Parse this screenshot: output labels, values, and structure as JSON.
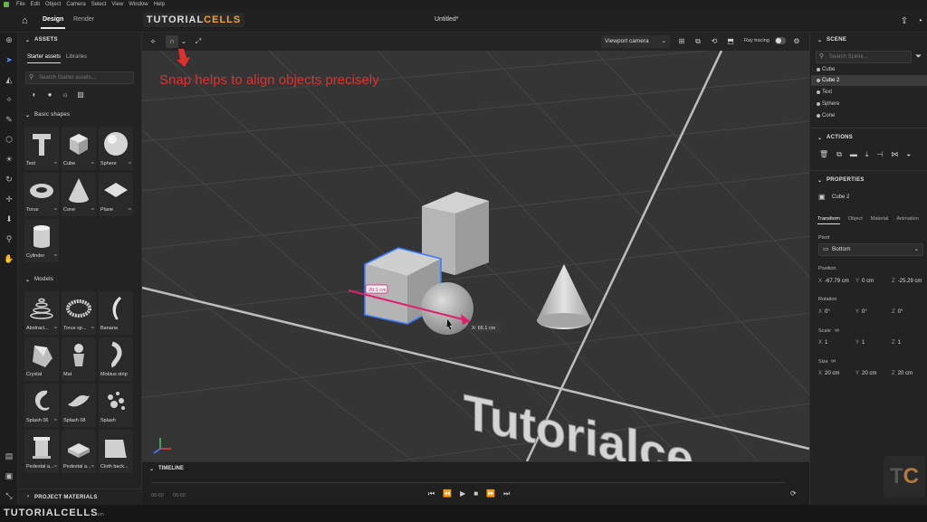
{
  "menu": [
    "File",
    "Edit",
    "Object",
    "Camera",
    "Select",
    "View",
    "Window",
    "Help"
  ],
  "header": {
    "tabs": [
      {
        "label": "Design"
      },
      {
        "label": "Render"
      }
    ],
    "brand_main": "TUTORIAL",
    "brand_accent": "CELLS",
    "doc_title": "Untitled*"
  },
  "assets": {
    "title": "ASSETS",
    "subtabs": [
      "Starter assets",
      "Libraries"
    ],
    "search_placeholder": "Search Starter assets...",
    "basic_shapes_title": "Basic shapes",
    "basic_shapes": [
      "Text",
      "Cube",
      "Sphere",
      "Torus",
      "Cone",
      "Plane",
      "Cylinder"
    ],
    "models_title": "Models",
    "models": [
      "Abstract...",
      "Torus sp...",
      "Banana",
      "Crystal",
      "Mat",
      "Mobius strip",
      "Splash 06",
      "Splash 08",
      "Splash",
      "Pedestal a...",
      "Pedestal a...",
      "Cloth back..."
    ],
    "project_materials": "PROJECT MATERIALS"
  },
  "viewport": {
    "camera_label": "Viewport camera",
    "raytracing_label": "Ray tracing",
    "annotation": "Snap helps to align objects precisely",
    "measure_1": "20.1 cm",
    "measure_2": "X: 65.1 cm",
    "floor_text": "Tutorialce"
  },
  "timeline": {
    "title": "TIMELINE",
    "time_start": "00:00",
    "time_end": "00:00"
  },
  "scene": {
    "title": "SCENE",
    "search_placeholder": "Search Scene...",
    "items": [
      "Cube",
      "Cube 2",
      "Text",
      "Sphere",
      "Cone"
    ],
    "selected_index": 1
  },
  "actions": {
    "title": "ACTIONS"
  },
  "properties": {
    "title": "PROPERTIES",
    "object_name": "Cube 2",
    "tabs": [
      "Transform",
      "Object",
      "Material",
      "Animation"
    ],
    "pivot_label": "Pivot",
    "pivot_value": "Bottom",
    "position_label": "Position",
    "position": {
      "x": "-67.79 cm",
      "y": "0 cm",
      "z": "-25.29 cm"
    },
    "rotation_label": "Rotation",
    "rotation": {
      "x": "0°",
      "y": "0°",
      "z": "0°"
    },
    "scale_label": "Scale",
    "scale": {
      "x": "1",
      "y": "1",
      "z": "1"
    },
    "size_label": "Size",
    "size": {
      "x": "20 cm",
      "y": "20 cm",
      "z": "20 cm"
    }
  },
  "footer": {
    "brand": "TUTORIALCELLS",
    "brand_small": ".com"
  },
  "logo": {
    "t": "T",
    "c": "C"
  }
}
